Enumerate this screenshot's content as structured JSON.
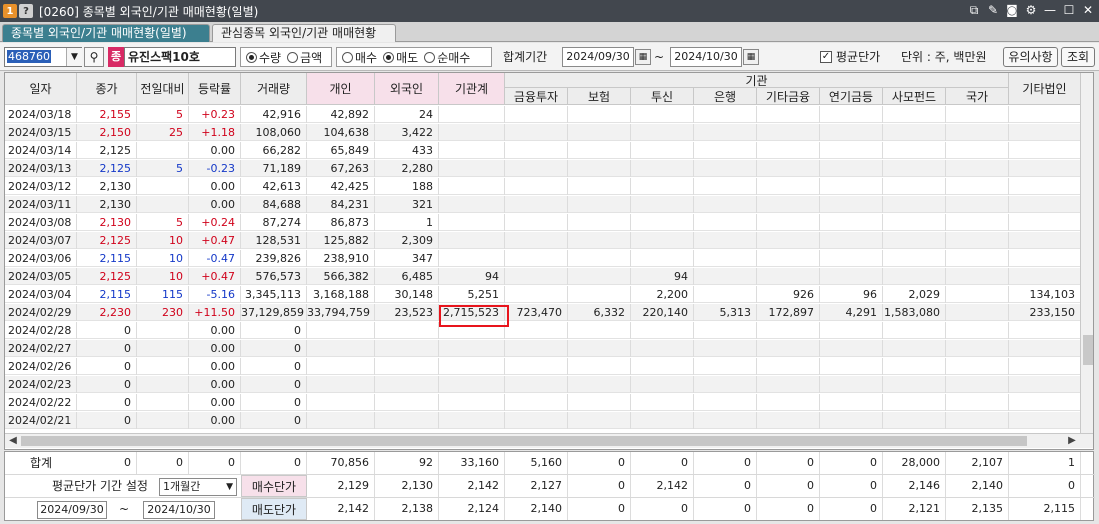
{
  "window": {
    "badge1": "1",
    "badge2": "?",
    "title": "[0260] 종목별 외국인/기관 매매현황(일별)"
  },
  "tabs": [
    {
      "label": "종목별 외국인/기관 매매현황(일별)"
    },
    {
      "label": "관심종목 외국인/기관 매매현황"
    }
  ],
  "toolbar": {
    "stock_code": "468760",
    "stock_badge": "종",
    "stock_name": "유진스팩10호",
    "unit_radios": [
      {
        "label": "수량",
        "checked": true
      },
      {
        "label": "금액",
        "checked": false
      }
    ],
    "trade_radios": [
      {
        "label": "매수",
        "checked": false
      },
      {
        "label": "매도",
        "checked": true
      },
      {
        "label": "순매수",
        "checked": false
      }
    ],
    "period_label": "합계기간",
    "date_from": "2024/09/30",
    "tilde": "~",
    "date_to": "2024/10/30",
    "avg_price_label": "평균단가",
    "avg_price_checked": true,
    "unit_label": "단위 : 주, 백만원",
    "notice_button": "유의사항",
    "query_button": "조회"
  },
  "grid": {
    "headers": {
      "date": "일자",
      "close": "종가",
      "change": "전일대비",
      "rate": "등락률",
      "volume": "거래량",
      "individual": "개인",
      "foreign": "외국인",
      "institution_total": "기관계",
      "institution_group": "기관",
      "financial_invest": "금융투자",
      "insurance": "보험",
      "trust": "투신",
      "bank": "은행",
      "other_finance": "기타금융",
      "pension": "연기금등",
      "private_fund": "사모펀드",
      "nation": "국가",
      "other_corp": "기타법인"
    },
    "rows": [
      {
        "date": "2024/03/18",
        "close": "2,155",
        "change": "5",
        "rate": "+0.23",
        "dir": "up",
        "volume": "42,916",
        "individual": "42,892",
        "foreign": "24",
        "inst": "",
        "fin": "",
        "ins": "",
        "trust": "",
        "bank": "",
        "etcfin": "",
        "pension": "",
        "pef": "",
        "nation": "",
        "corp": ""
      },
      {
        "date": "2024/03/15",
        "close": "2,150",
        "change": "25",
        "rate": "+1.18",
        "dir": "up",
        "volume": "108,060",
        "individual": "104,638",
        "foreign": "3,422",
        "inst": "",
        "fin": "",
        "ins": "",
        "trust": "",
        "bank": "",
        "etcfin": "",
        "pension": "",
        "pef": "",
        "nation": "",
        "corp": ""
      },
      {
        "date": "2024/03/14",
        "close": "2,125",
        "change": "",
        "rate": "0.00",
        "dir": "flat",
        "volume": "66,282",
        "individual": "65,849",
        "foreign": "433",
        "inst": "",
        "fin": "",
        "ins": "",
        "trust": "",
        "bank": "",
        "etcfin": "",
        "pension": "",
        "pef": "",
        "nation": "",
        "corp": ""
      },
      {
        "date": "2024/03/13",
        "close": "2,125",
        "change": "5",
        "rate": "-0.23",
        "dir": "down",
        "volume": "71,189",
        "individual": "67,263",
        "foreign": "2,280",
        "inst": "",
        "fin": "",
        "ins": "",
        "trust": "",
        "bank": "",
        "etcfin": "",
        "pension": "",
        "pef": "",
        "nation": "",
        "corp": ""
      },
      {
        "date": "2024/03/12",
        "close": "2,130",
        "change": "",
        "rate": "0.00",
        "dir": "flat",
        "volume": "42,613",
        "individual": "42,425",
        "foreign": "188",
        "inst": "",
        "fin": "",
        "ins": "",
        "trust": "",
        "bank": "",
        "etcfin": "",
        "pension": "",
        "pef": "",
        "nation": "",
        "corp": ""
      },
      {
        "date": "2024/03/11",
        "close": "2,130",
        "change": "",
        "rate": "0.00",
        "dir": "flat",
        "volume": "84,688",
        "individual": "84,231",
        "foreign": "321",
        "inst": "",
        "fin": "",
        "ins": "",
        "trust": "",
        "bank": "",
        "etcfin": "",
        "pension": "",
        "pef": "",
        "nation": "",
        "corp": ""
      },
      {
        "date": "2024/03/08",
        "close": "2,130",
        "change": "5",
        "rate": "+0.24",
        "dir": "up",
        "volume": "87,274",
        "individual": "86,873",
        "foreign": "1",
        "inst": "",
        "fin": "",
        "ins": "",
        "trust": "",
        "bank": "",
        "etcfin": "",
        "pension": "",
        "pef": "",
        "nation": "",
        "corp": ""
      },
      {
        "date": "2024/03/07",
        "close": "2,125",
        "change": "10",
        "rate": "+0.47",
        "dir": "up",
        "volume": "128,531",
        "individual": "125,882",
        "foreign": "2,309",
        "inst": "",
        "fin": "",
        "ins": "",
        "trust": "",
        "bank": "",
        "etcfin": "",
        "pension": "",
        "pef": "",
        "nation": "",
        "corp": ""
      },
      {
        "date": "2024/03/06",
        "close": "2,115",
        "change": "10",
        "rate": "-0.47",
        "dir": "down",
        "volume": "239,826",
        "individual": "238,910",
        "foreign": "347",
        "inst": "",
        "fin": "",
        "ins": "",
        "trust": "",
        "bank": "",
        "etcfin": "",
        "pension": "",
        "pef": "",
        "nation": "",
        "corp": ""
      },
      {
        "date": "2024/03/05",
        "close": "2,125",
        "change": "10",
        "rate": "+0.47",
        "dir": "up",
        "volume": "576,573",
        "individual": "566,382",
        "foreign": "6,485",
        "inst": "94",
        "fin": "",
        "ins": "",
        "trust": "94",
        "bank": "",
        "etcfin": "",
        "pension": "",
        "pef": "",
        "nation": "",
        "corp": ""
      },
      {
        "date": "2024/03/04",
        "close": "2,115",
        "change": "115",
        "rate": "-5.16",
        "dir": "down",
        "volume": "3,345,113",
        "individual": "3,168,188",
        "foreign": "30,148",
        "inst": "5,251",
        "fin": "",
        "ins": "",
        "trust": "2,200",
        "bank": "",
        "etcfin": "926",
        "pension": "96",
        "pef": "2,029",
        "nation": "",
        "corp": "134,103"
      },
      {
        "date": "2024/02/29",
        "close": "2,230",
        "change": "230",
        "rate": "+11.50",
        "dir": "up",
        "volume": "37,129,859",
        "individual": "33,794,759",
        "foreign": "23,523",
        "inst": "2,715,523",
        "fin": "723,470",
        "ins": "6,332",
        "trust": "220,140",
        "bank": "5,313",
        "etcfin": "172,897",
        "pension": "4,291",
        "pef": "1,583,080",
        "nation": "",
        "corp": "233,150"
      },
      {
        "date": "2024/02/28",
        "close": "0",
        "change": "",
        "rate": "0.00",
        "dir": "flat",
        "volume": "0",
        "individual": "",
        "foreign": "",
        "inst": "",
        "fin": "",
        "ins": "",
        "trust": "",
        "bank": "",
        "etcfin": "",
        "pension": "",
        "pef": "",
        "nation": "",
        "corp": ""
      },
      {
        "date": "2024/02/27",
        "close": "0",
        "change": "",
        "rate": "0.00",
        "dir": "flat",
        "volume": "0",
        "individual": "",
        "foreign": "",
        "inst": "",
        "fin": "",
        "ins": "",
        "trust": "",
        "bank": "",
        "etcfin": "",
        "pension": "",
        "pef": "",
        "nation": "",
        "corp": ""
      },
      {
        "date": "2024/02/26",
        "close": "0",
        "change": "",
        "rate": "0.00",
        "dir": "flat",
        "volume": "0",
        "individual": "",
        "foreign": "",
        "inst": "",
        "fin": "",
        "ins": "",
        "trust": "",
        "bank": "",
        "etcfin": "",
        "pension": "",
        "pef": "",
        "nation": "",
        "corp": ""
      },
      {
        "date": "2024/02/23",
        "close": "0",
        "change": "",
        "rate": "0.00",
        "dir": "flat",
        "volume": "0",
        "individual": "",
        "foreign": "",
        "inst": "",
        "fin": "",
        "ins": "",
        "trust": "",
        "bank": "",
        "etcfin": "",
        "pension": "",
        "pef": "",
        "nation": "",
        "corp": ""
      },
      {
        "date": "2024/02/22",
        "close": "0",
        "change": "",
        "rate": "0.00",
        "dir": "flat",
        "volume": "0",
        "individual": "",
        "foreign": "",
        "inst": "",
        "fin": "",
        "ins": "",
        "trust": "",
        "bank": "",
        "etcfin": "",
        "pension": "",
        "pef": "",
        "nation": "",
        "corp": ""
      },
      {
        "date": "2024/02/21",
        "close": "0",
        "change": "",
        "rate": "0.00",
        "dir": "flat",
        "volume": "0",
        "individual": "",
        "foreign": "",
        "inst": "",
        "fin": "",
        "ins": "",
        "trust": "",
        "bank": "",
        "etcfin": "",
        "pension": "",
        "pef": "",
        "nation": "",
        "corp": ""
      }
    ]
  },
  "summary": {
    "total_label": "합계",
    "total_values": [
      "0",
      "0",
      "0",
      "0",
      "70,856",
      "92",
      "33,160",
      "5,160",
      "0",
      "0",
      "0",
      "0",
      "0",
      "28,000",
      "2,107",
      "1"
    ],
    "avg_period_label": "평균단가 기간 설정",
    "avg_period_value": "1개월간",
    "buy_price_label": "매수단가",
    "buy_values": [
      "2,129",
      "2,130",
      "2,142",
      "2,127",
      "0",
      "2,142",
      "0",
      "0",
      "0",
      "2,146",
      "2,140",
      "0"
    ],
    "sell_price_label": "매도단가",
    "sell_values": [
      "2,142",
      "2,138",
      "2,124",
      "2,140",
      "0",
      "0",
      "0",
      "0",
      "0",
      "2,121",
      "2,135",
      "2,115"
    ],
    "range_from": "2024/09/30",
    "range_tilde": "~",
    "range_to": "2024/10/30"
  }
}
